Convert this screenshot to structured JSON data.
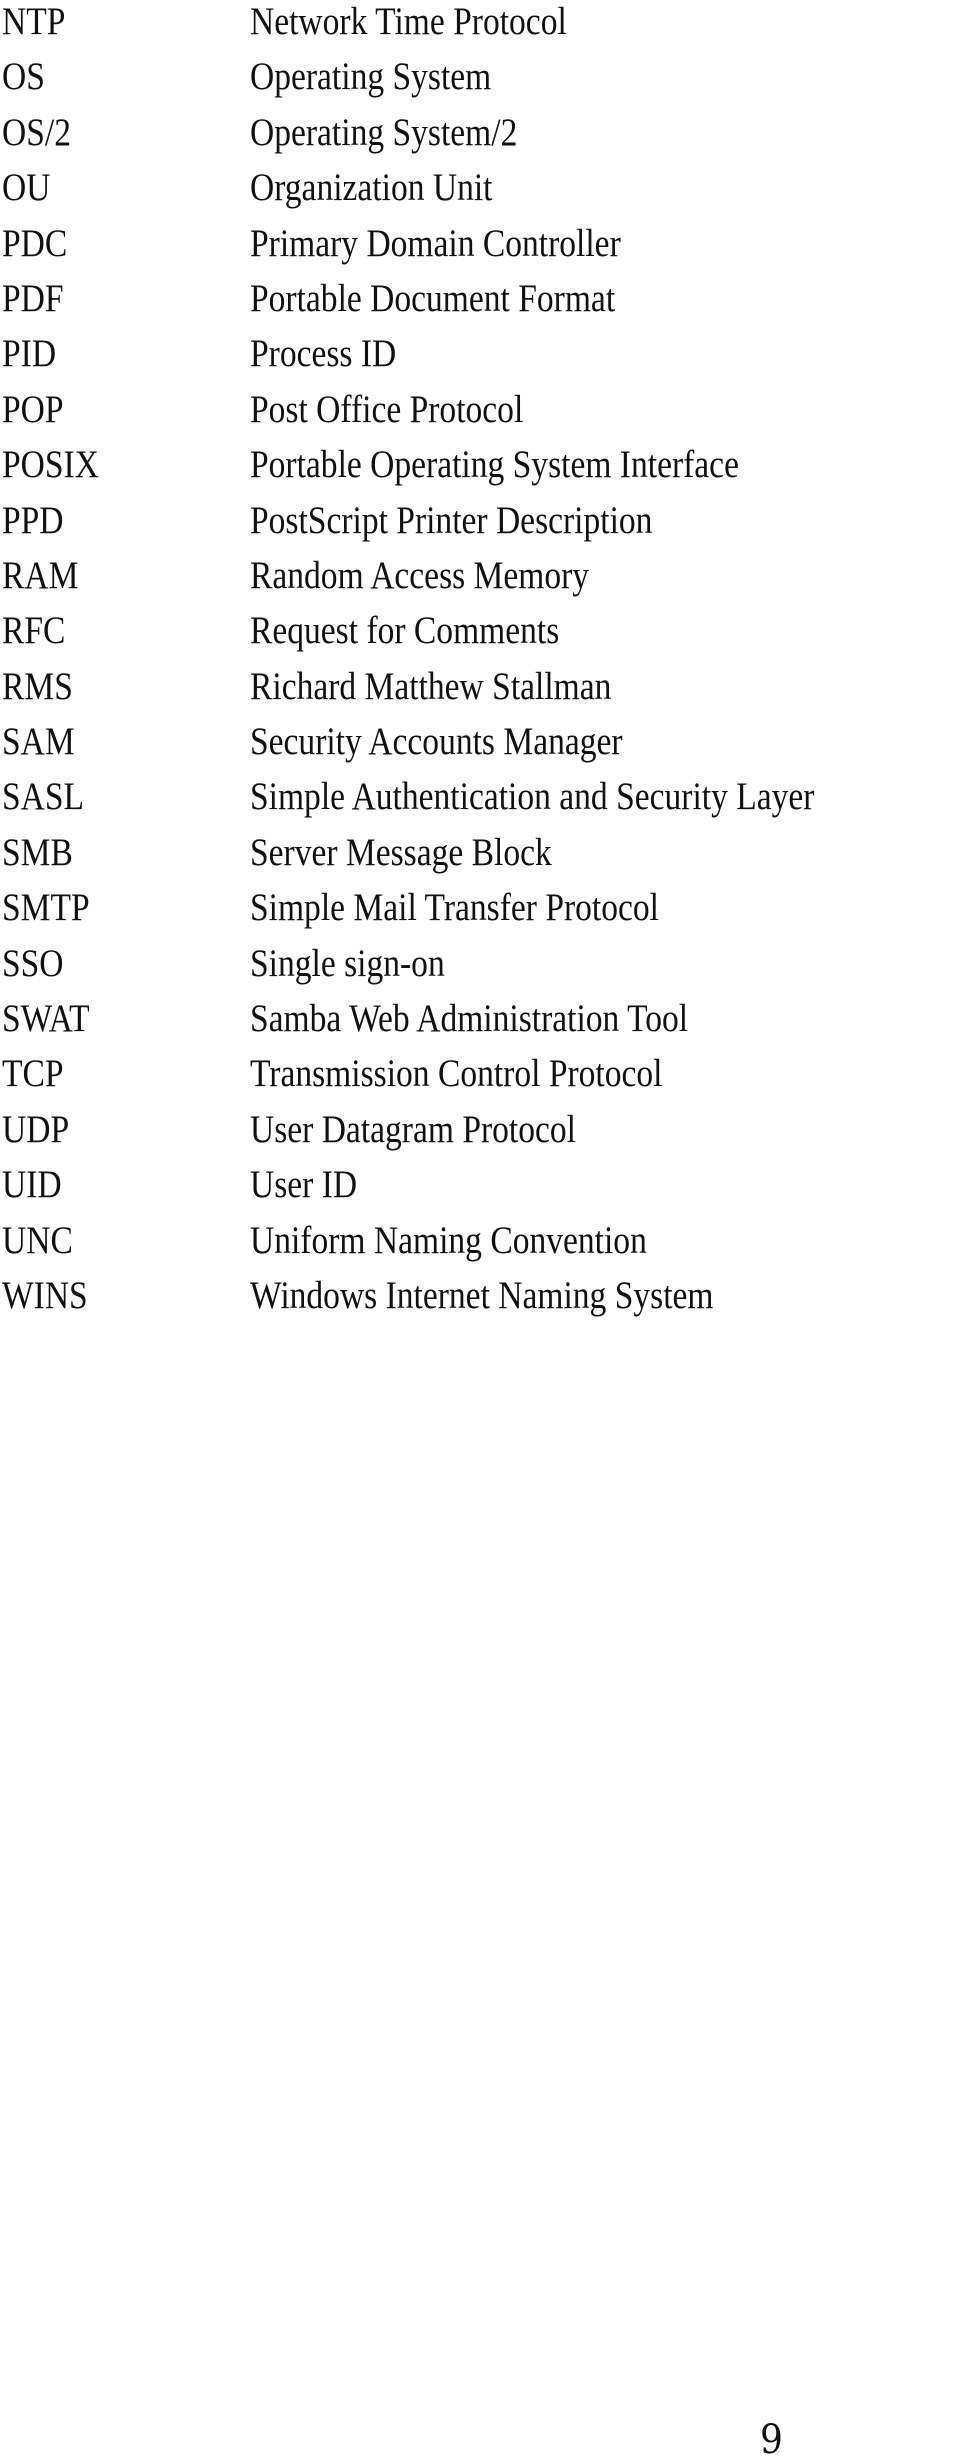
{
  "glossary": {
    "entries": [
      {
        "abbr": "NTP",
        "term": "Network Time Protocol"
      },
      {
        "abbr": "OS",
        "term": "Operating System"
      },
      {
        "abbr": "OS/2",
        "term": "Operating System/2"
      },
      {
        "abbr": "OU",
        "term": "Organization Unit"
      },
      {
        "abbr": "PDC",
        "term": "Primary Domain Controller"
      },
      {
        "abbr": "PDF",
        "term": "Portable Document Format"
      },
      {
        "abbr": "PID",
        "term": "Process ID"
      },
      {
        "abbr": "POP",
        "term": "Post Office Protocol"
      },
      {
        "abbr": "POSIX",
        "term": "Portable Operating System Interface"
      },
      {
        "abbr": "PPD",
        "term": "PostScript Printer Description"
      },
      {
        "abbr": "RAM",
        "term": "Random Access Memory"
      },
      {
        "abbr": "RFC",
        "term": "Request for Comments"
      },
      {
        "abbr": "RMS",
        "term": "Richard Matthew Stallman"
      },
      {
        "abbr": "SAM",
        "term": "Security Accounts Manager"
      },
      {
        "abbr": "SASL",
        "term": "Simple Authentication and Security Layer"
      },
      {
        "abbr": "SMB",
        "term": "Server Message Block"
      },
      {
        "abbr": "SMTP",
        "term": "Simple Mail Transfer Protocol"
      },
      {
        "abbr": "SSO",
        "term": "Single sign-on"
      },
      {
        "abbr": "SWAT",
        "term": "Samba Web Administration Tool"
      },
      {
        "abbr": "TCP",
        "term": "Transmission Control Protocol"
      },
      {
        "abbr": "UDP",
        "term": "User Datagram Protocol"
      },
      {
        "abbr": "UID",
        "term": "User ID"
      },
      {
        "abbr": "UNC",
        "term": "Uniform Naming Convention"
      },
      {
        "abbr": "WINS",
        "term": "Windows Internet Naming System"
      }
    ]
  },
  "footer": {
    "page_number": "9"
  }
}
